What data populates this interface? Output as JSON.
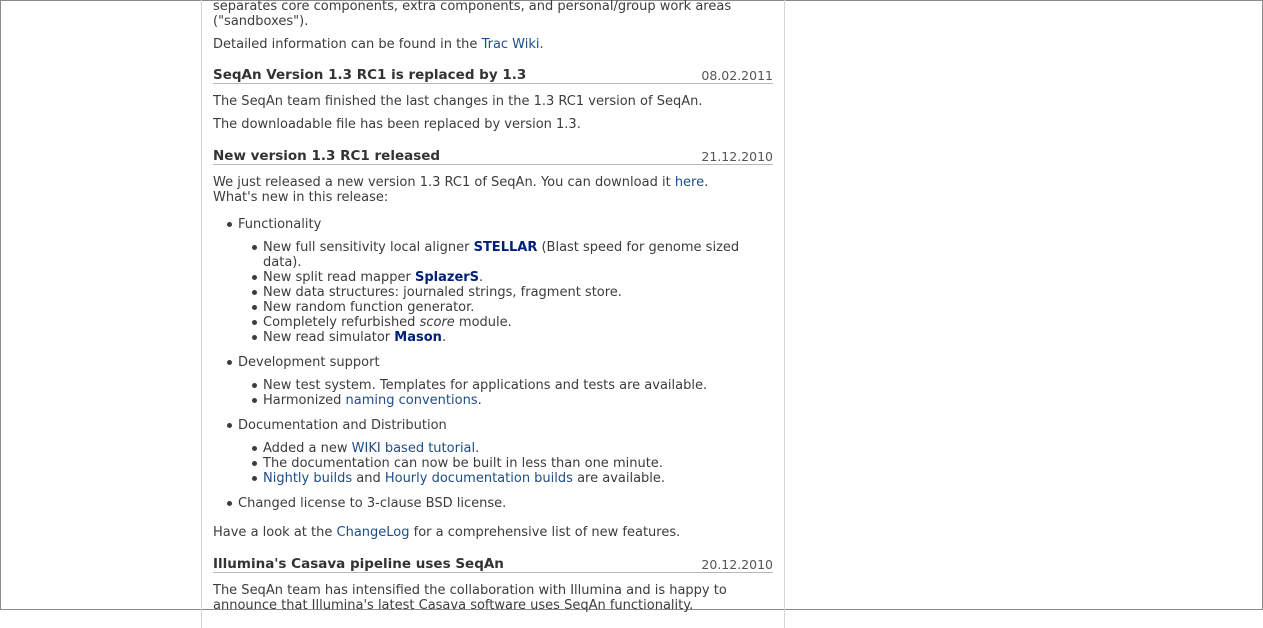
{
  "intro": {
    "line1": "separates core components, extra components, and personal/group work areas",
    "line2": "(\"sandboxes\").",
    "detail_prefix": "Detailed information can be found in the ",
    "detail_link": "Trac Wiki",
    "detail_suffix": "."
  },
  "news": [
    {
      "title": "SeqAn Version 1.3 RC1 is replaced by 1.3",
      "date": "08.02.2011",
      "p1": "The SeqAn team finished the last changes in the 1.3 RC1 version of SeqAn.",
      "p2": "The downloadable file has been replaced by version 1.3."
    },
    {
      "title": "New version 1.3 RC1 released",
      "date": "21.12.2010",
      "intro_prefix": "We just released a new version 1.3 RC1 of SeqAn. You can download it ",
      "intro_link": "here",
      "intro_suffix": ".",
      "intro_line2": "What's new in this release:",
      "sections": {
        "functionality": {
          "label": "Functionality",
          "i1_pre": "New full sensitivity local aligner ",
          "i1_link": "STELLAR",
          "i1_post": " (Blast speed for genome sized",
          "i1_cont": "data).",
          "i2_pre": "New split read mapper ",
          "i2_link": "SplazerS",
          "i2_post": ".",
          "i3": "New data structures: journaled strings, fragment store.",
          "i4": "New random function generator.",
          "i5_pre": "Completely refurbished ",
          "i5_em": "score",
          "i5_post": " module.",
          "i6_pre": "New read simulator ",
          "i6_link": "Mason",
          "i6_post": "."
        },
        "development": {
          "label": "Development support",
          "i1": "New test system. Templates for applications and tests are available.",
          "i2_pre": "Harmonized ",
          "i2_link": "naming conventions",
          "i2_post": "."
        },
        "documentation": {
          "label": "Documentation and Distribution",
          "i1_pre": "Added a new ",
          "i1_link": "WIKI based tutorial",
          "i1_post": ".",
          "i2": "The documentation can now be built in less than one minute.",
          "i3_link1": "Nightly builds",
          "i3_mid": " and ",
          "i3_link2": "Hourly documentation builds",
          "i3_post": " are available."
        },
        "license": {
          "label": "Changed license to 3-clause BSD license."
        }
      },
      "outro_prefix": "Have a look at the ",
      "outro_link": "ChangeLog",
      "outro_suffix": " for a comprehensive list of new features."
    },
    {
      "title": "Illumina's Casava pipeline uses SeqAn",
      "date": "20.12.2010",
      "p1": "The SeqAn team has intensified the collaboration with Illumina and is happy to",
      "p2": "announce that Illumina's latest Casava software uses SeqAn functionality."
    }
  ]
}
